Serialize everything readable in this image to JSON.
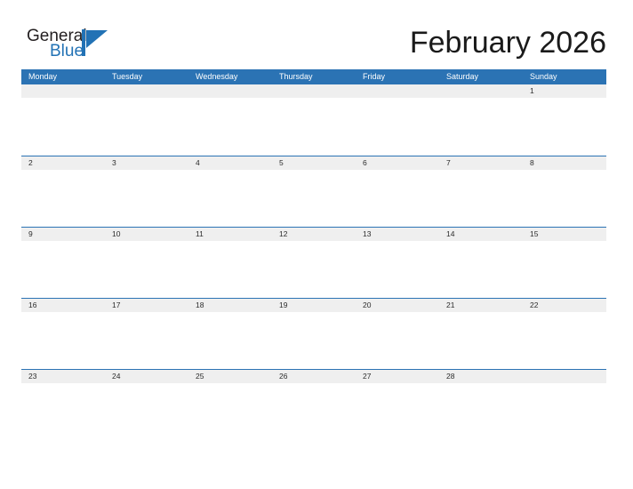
{
  "brand": {
    "name_top": "General",
    "name_bottom": "Blue",
    "mark": "pennant-flag-icon",
    "color_dark": "#231f20",
    "color_blue": "#2272b5"
  },
  "header": {
    "title": "February 2026",
    "month": "February",
    "year": "2026"
  },
  "colors": {
    "header_blue": "#2b73b4",
    "rule_blue": "#2b73b4",
    "day_band_gray": "#efefef",
    "page_background": "#ffffff",
    "day_number_text": "#2b2b2b",
    "dow_text": "#ffffff"
  },
  "calendar": {
    "weekday_headers": [
      "Monday",
      "Tuesday",
      "Wednesday",
      "Thursday",
      "Friday",
      "Saturday",
      "Sunday"
    ],
    "weeks": [
      {
        "days": [
          "",
          "",
          "",
          "",
          "",
          "",
          "1"
        ]
      },
      {
        "days": [
          "2",
          "3",
          "4",
          "5",
          "6",
          "7",
          "8"
        ]
      },
      {
        "days": [
          "9",
          "10",
          "11",
          "12",
          "13",
          "14",
          "15"
        ]
      },
      {
        "days": [
          "16",
          "17",
          "18",
          "19",
          "20",
          "21",
          "22"
        ]
      },
      {
        "days": [
          "23",
          "24",
          "25",
          "26",
          "27",
          "28",
          ""
        ]
      }
    ]
  }
}
